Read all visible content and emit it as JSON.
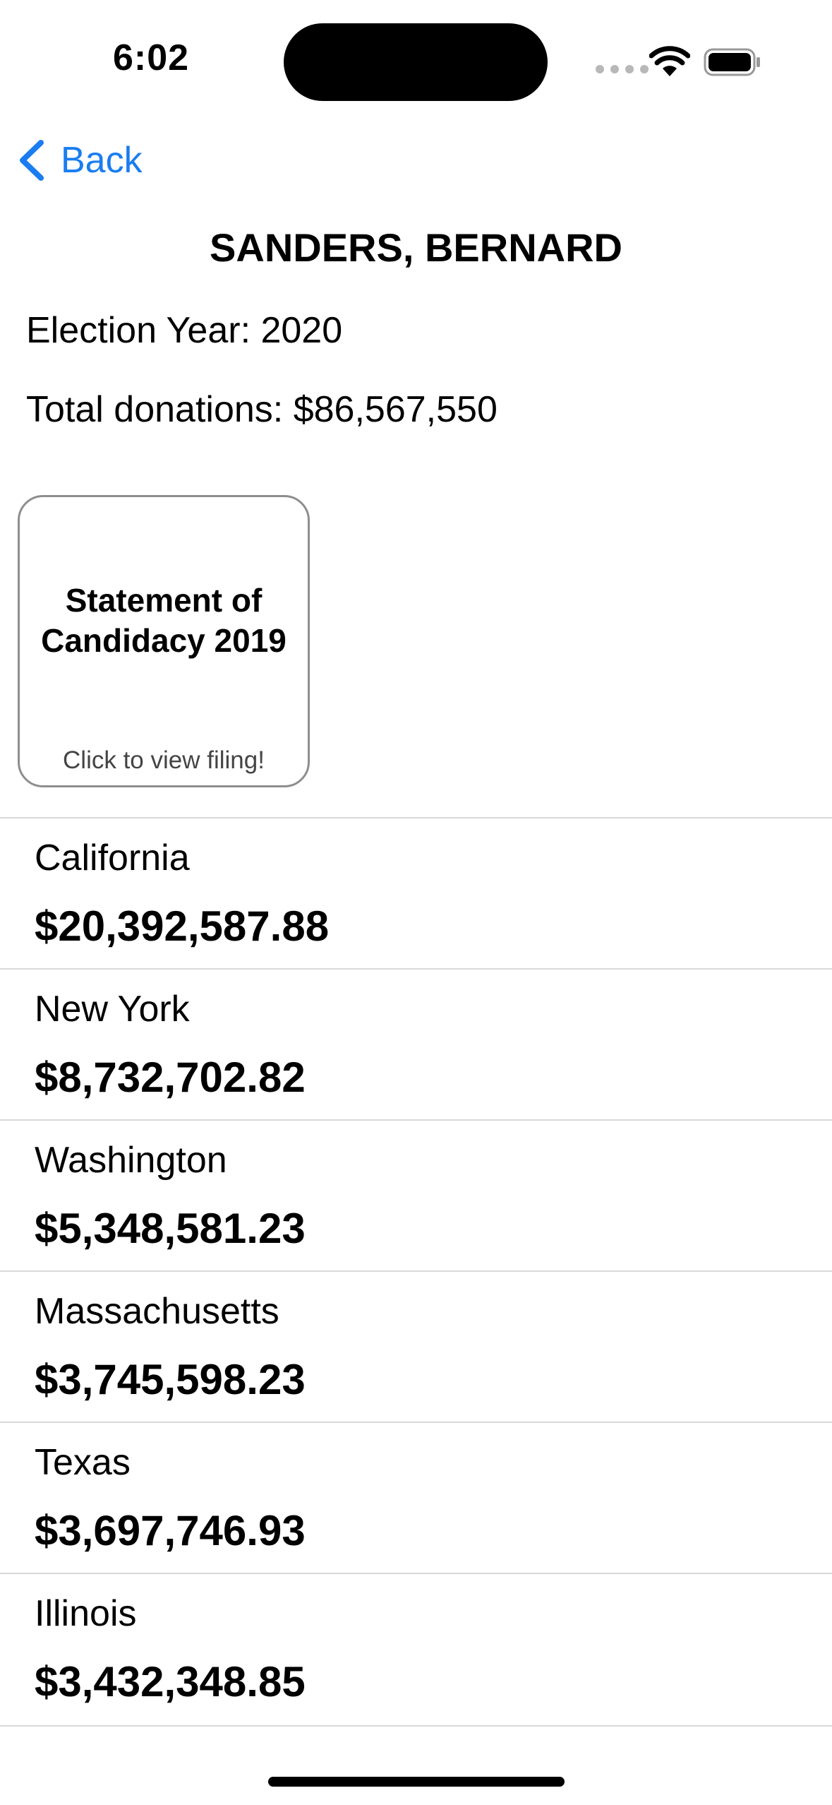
{
  "status_bar": {
    "time": "6:02"
  },
  "nav": {
    "back_label": "Back"
  },
  "candidate": {
    "name": "SANDERS, BERNARD",
    "election_year": "Election Year: 2020",
    "total_donations": "Total donations: $86,567,550"
  },
  "filing_card": {
    "title": "Statement of Candidacy 2019",
    "subtitle": "Click to view filing!"
  },
  "states": [
    {
      "name": "California",
      "amount": "$20,392,587.88"
    },
    {
      "name": "New York",
      "amount": "$8,732,702.82"
    },
    {
      "name": "Washington",
      "amount": "$5,348,581.23"
    },
    {
      "name": "Massachusetts",
      "amount": "$3,745,598.23"
    },
    {
      "name": "Texas",
      "amount": "$3,697,746.93"
    },
    {
      "name": "Illinois",
      "amount": "$3,432,348.85"
    }
  ],
  "colors": {
    "accent": "#1a7df0",
    "divider": "#d8d8d8",
    "card_border": "#8e8e8e"
  }
}
